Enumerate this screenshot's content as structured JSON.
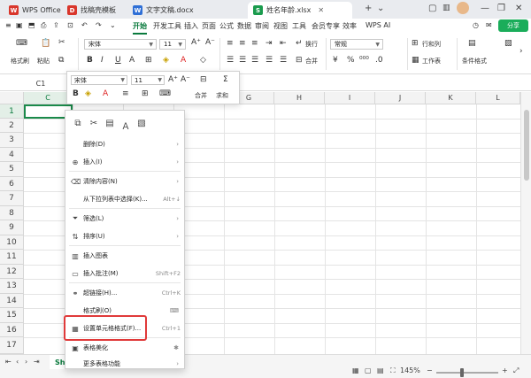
{
  "tabs": [
    {
      "label": "WPS Office",
      "icon": "W"
    },
    {
      "label": "找稿壳模板",
      "icon": "D"
    },
    {
      "label": "文字文稿.docx",
      "icon": "W"
    },
    {
      "label": "姓名年龄.xlsx",
      "icon": "S"
    }
  ],
  "menu": [
    "开始",
    "开发工具",
    "插入",
    "页面",
    "公式",
    "数据",
    "审阅",
    "视图",
    "工具",
    "会员专享",
    "效率",
    "WPS AI"
  ],
  "share_label": "分享",
  "ribbon": {
    "format_painter": "格式刷",
    "paste": "粘贴",
    "font": "宋体",
    "size": "11",
    "wrap": "换行",
    "merge": "合并",
    "numfmt": "常规",
    "rows_cols": "行和列",
    "worksheet": "工作表",
    "cond_format": "条件格式"
  },
  "namebox": "C1",
  "columns": [
    "C",
    "D",
    "E",
    "F",
    "G",
    "H",
    "I",
    "J",
    "K",
    "L"
  ],
  "rows": [
    "1",
    "2",
    "3",
    "4",
    "5",
    "6",
    "7",
    "8",
    "9",
    "10",
    "11",
    "12",
    "13",
    "14",
    "15",
    "16",
    "17"
  ],
  "mini_toolbar": {
    "font": "宋体",
    "size": "11",
    "merge": "合并",
    "sum": "求和"
  },
  "context_menu": {
    "items": [
      {
        "label": "删除(D)",
        "shortcut": "",
        "arrow": true,
        "icon": ""
      },
      {
        "label": "插入(I)",
        "shortcut": "",
        "arrow": true,
        "icon": "insert-icon"
      },
      {
        "label": "清除内容(N)",
        "shortcut": "",
        "arrow": true,
        "icon": "clear-icon"
      },
      {
        "label": "从下拉列表中选择(K)...",
        "shortcut": "Alt+↓",
        "arrow": false,
        "icon": ""
      },
      {
        "label": "筛选(L)",
        "shortcut": "",
        "arrow": true,
        "icon": "filter-icon"
      },
      {
        "label": "排序(U)",
        "shortcut": "",
        "arrow": true,
        "icon": "sort-icon"
      },
      {
        "label": "插入图表",
        "shortcut": "",
        "arrow": false,
        "icon": "chart-icon"
      },
      {
        "label": "插入批注(M)",
        "shortcut": "Shift+F2",
        "arrow": false,
        "icon": "comment-icon"
      },
      {
        "label": "超链接(H)...",
        "shortcut": "Ctrl+K",
        "arrow": false,
        "icon": "link-icon"
      },
      {
        "label": "格式刷(O)",
        "shortcut": "",
        "arrow": false,
        "icon": "brush-icon"
      },
      {
        "label": "设置单元格格式(F)...",
        "shortcut": "Ctrl+1",
        "arrow": false,
        "icon": "format-cells-icon"
      },
      {
        "label": "表格美化",
        "shortcut": "",
        "arrow": false,
        "icon": "beautify-icon"
      },
      {
        "label": "更多表格功能",
        "shortcut": "",
        "arrow": true,
        "icon": ""
      }
    ]
  },
  "status": {
    "sheet": "She",
    "zoom": "145%"
  },
  "colors": {
    "accent": "#0a7a3d",
    "share_bg": "#1aad5a",
    "highlight": "#e03a3a"
  }
}
